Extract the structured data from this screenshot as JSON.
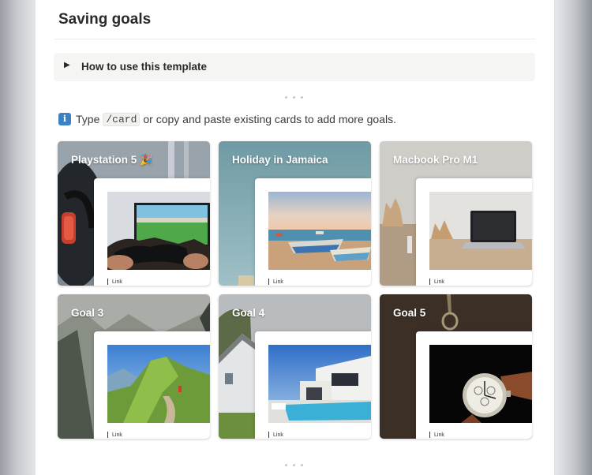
{
  "page": {
    "title": "Saving goals"
  },
  "toggle": {
    "label": "How to use this template"
  },
  "hint": {
    "prefix": "Type",
    "code": "/card",
    "suffix": "or copy and paste existing cards to add more goals.",
    "icon": "info-icon"
  },
  "cards": [
    {
      "name": "Playstation 5 🎉",
      "link": "Link"
    },
    {
      "name": "Holiday in Jamaica",
      "link": "Link"
    },
    {
      "name": "Macbook Pro M1",
      "link": "Link"
    },
    {
      "name": "Goal 3",
      "link": "Link"
    },
    {
      "name": "Goal 4",
      "link": "Link"
    },
    {
      "name": "Goal 5",
      "link": "Link"
    }
  ]
}
